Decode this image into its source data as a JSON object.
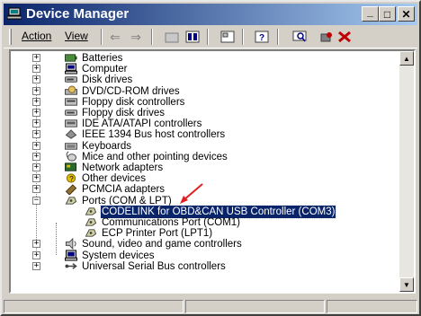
{
  "window": {
    "title": "Device Manager",
    "minimize_glyph": "_",
    "maximize_glyph": "□",
    "close_glyph": "✕"
  },
  "menu": {
    "action": "Action",
    "view": "View"
  },
  "toolbar": {
    "icons": [
      "back-arrow-icon",
      "forward-arrow-icon",
      "up-folder-icon",
      "show-hide-tree-icon",
      "properties-icon",
      "help-icon",
      "scan-hardware-icon",
      "update-driver-icon",
      "uninstall-icon"
    ]
  },
  "tree": {
    "items": [
      {
        "label": "Batteries",
        "icon": "battery-icon",
        "expander": "+"
      },
      {
        "label": "Computer",
        "icon": "computer-icon",
        "expander": "+"
      },
      {
        "label": "Disk drives",
        "icon": "disk-drive-icon",
        "expander": "+"
      },
      {
        "label": "DVD/CD-ROM drives",
        "icon": "dvd-icon",
        "expander": "+"
      },
      {
        "label": "Floppy disk controllers",
        "icon": "floppy-controller-icon",
        "expander": "+"
      },
      {
        "label": "Floppy disk drives",
        "icon": "floppy-drive-icon",
        "expander": "+"
      },
      {
        "label": "IDE ATA/ATAPI controllers",
        "icon": "ide-controller-icon",
        "expander": "+"
      },
      {
        "label": "IEEE 1394 Bus host controllers",
        "icon": "firewire-icon",
        "expander": "+"
      },
      {
        "label": "Keyboards",
        "icon": "keyboard-icon",
        "expander": "+"
      },
      {
        "label": "Mice and other pointing devices",
        "icon": "mouse-icon",
        "expander": "+"
      },
      {
        "label": "Network adapters",
        "icon": "network-adapter-icon",
        "expander": "+"
      },
      {
        "label": "Other devices",
        "icon": "unknown-device-icon",
        "expander": "+"
      },
      {
        "label": "PCMCIA adapters",
        "icon": "pcmcia-icon",
        "expander": "+"
      },
      {
        "label": "Ports (COM & LPT)",
        "icon": "port-icon",
        "expander": "−"
      },
      {
        "label": "CODELINK for OBD&CAN USB Controller (COM3)",
        "icon": "port-icon",
        "child": true,
        "selected": true
      },
      {
        "label": "Communications Port (COM1)",
        "icon": "port-icon",
        "child": true
      },
      {
        "label": "ECP Printer Port (LPT1)",
        "icon": "port-icon",
        "child": true
      },
      {
        "label": "Sound, video and game controllers",
        "icon": "sound-icon",
        "expander": "+"
      },
      {
        "label": "System devices",
        "icon": "system-devices-icon",
        "expander": "+"
      },
      {
        "label": "Universal Serial Bus controllers",
        "icon": "usb-icon",
        "expander": "+"
      }
    ]
  },
  "annotation": {
    "arrow_color": "#e02020"
  },
  "colors": {
    "titlebar_start": "#0a246a",
    "titlebar_end": "#a6caf0",
    "selection": "#0a246a"
  }
}
